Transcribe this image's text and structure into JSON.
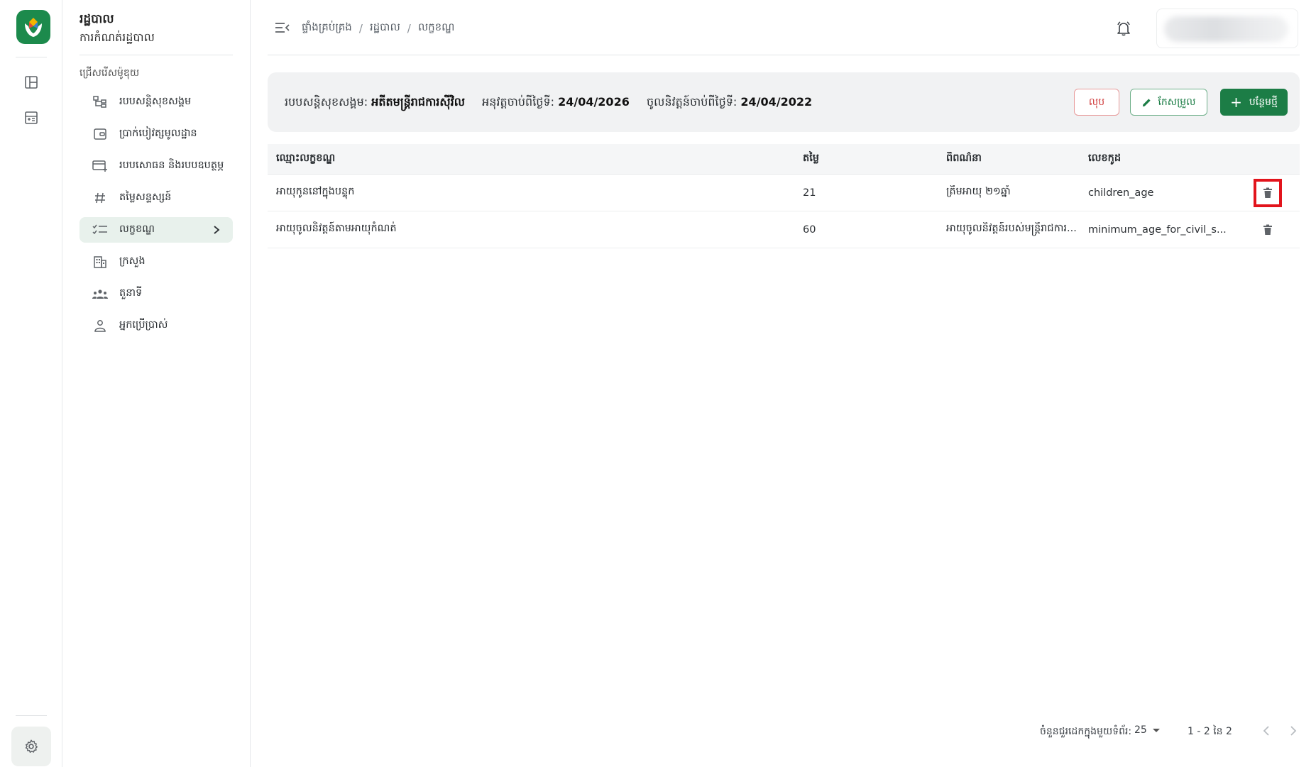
{
  "rail": {
    "icons": [
      "logo-icon",
      "dashboard-icon",
      "calculator-icon",
      "settings-icon"
    ]
  },
  "sidebar": {
    "title": "រដ្ឋបាល",
    "subtitle": "ការកំណត់រដ្ឋបាល",
    "section_label": "ជ្រើសរើសម៉ូឌុយ",
    "items": [
      {
        "label": "របបសន្តិសុខសង្គម",
        "icon": "hierarchy-icon"
      },
      {
        "label": "ប្រាក់បៀវត្សមូលដ្ឋាន",
        "icon": "wallet-icon"
      },
      {
        "label": "របបសោធន និងរបបឧបត្ថម្ភ",
        "icon": "card-add-icon"
      },
      {
        "label": "តម្លៃសន្ទស្សន៍",
        "icon": "hash-icon"
      },
      {
        "label": "លក្ខខណ្ឌ",
        "icon": "checklist-icon",
        "active": true
      },
      {
        "label": "ក្រសួង",
        "icon": "building-icon"
      },
      {
        "label": "តួនាទី",
        "icon": "group-icon"
      },
      {
        "label": "អ្នកប្រើប្រាស់",
        "icon": "user-icon"
      }
    ]
  },
  "topbar": {
    "breadcrumbs": [
      "ផ្ទាំងគ្រប់គ្រង",
      "រដ្ឋបាល",
      "លក្ខខណ្ឌ"
    ],
    "breadcrumb_sep": "/"
  },
  "info": {
    "scheme_label": "របបសន្តិសុខសង្គម:",
    "scheme_value": "អតីតមន្ត្រីរាជការស៊ីវិល",
    "effective_label": "អនុវត្តចាប់ពីថ្ងៃទី:",
    "effective_value": "24/04/2026",
    "enforced_label": "ចូលនិវត្តន៍ចាប់ពីថ្ងៃទី:",
    "enforced_value": "24/04/2022",
    "delete_label": "លុប",
    "edit_label": "កែសម្រួល",
    "new_label": "បន្ថែមថ្មី"
  },
  "table": {
    "columns": [
      "ឈ្មោះលក្ខខណ្ឌ",
      "តម្លៃ",
      "ពិពណ៌នា",
      "លេខកូដ"
    ],
    "rows": [
      {
        "name": "អាយុកូននៅក្នុងបន្ទុក",
        "value": "21",
        "description": "ត្រឹមអាយុ ២១ឆ្នាំ",
        "code": "children_age"
      },
      {
        "name": "អាយុចូលនិវត្តន៍តាមអាយុកំណត់",
        "value": "60",
        "description": "អាយុចូលនិវត្តន៍របស់មន្ត្រីរាជការ...",
        "code": "minimum_age_for_civil_s..."
      }
    ]
  },
  "pagination": {
    "rows_per_page_label": "ចំនួនជួរដេកក្នុងមួយទំព័រ:",
    "rows_per_page": "25",
    "range": "1 - 2 នៃ 2"
  },
  "colors": {
    "brand": "#1c7d46",
    "danger": "#d03a3a",
    "highlight": "#e2141c"
  }
}
